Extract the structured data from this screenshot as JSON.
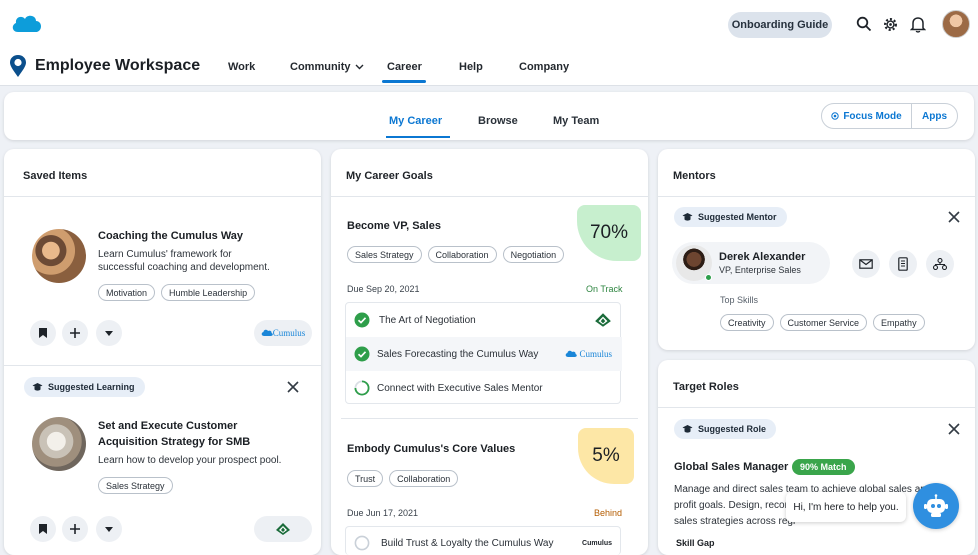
{
  "header": {
    "brand_title": "Employee Workspace",
    "onboarding_label": "Onboarding Guide",
    "nav": [
      {
        "label": "Work"
      },
      {
        "label": "Community"
      },
      {
        "label": "Career"
      },
      {
        "label": "Help"
      },
      {
        "label": "Company"
      }
    ],
    "active_nav": "Career",
    "icons": [
      "search-icon",
      "gear-icon",
      "bell-icon",
      "user-avatar"
    ]
  },
  "subnav": {
    "tabs": [
      {
        "label": "My Career"
      },
      {
        "label": "Browse"
      },
      {
        "label": "My Team"
      }
    ],
    "active_tab": "My Career",
    "focus_mode_label": "Focus Mode",
    "apps_label": "Apps"
  },
  "saved_items": {
    "title": "Saved Items",
    "item1": {
      "title": "Coaching the Cumulus Way",
      "desc_line1": "Learn Cumulus' framework for",
      "desc_line2": "successful coaching and development.",
      "tags": [
        "Motivation",
        "Humble Leadership"
      ],
      "logo_text": "Cumulus"
    },
    "suggested_label": "Suggested Learning",
    "item2": {
      "title_line1": "Set and Execute Customer",
      "title_line2": "Acquisition Strategy for SMB",
      "desc": "Learn how to develop your prospect pool.",
      "tags": [
        "Sales Strategy"
      ]
    }
  },
  "career_goals": {
    "title": "My Career Goals",
    "goal1": {
      "title": "Become VP, Sales",
      "percent": "70%",
      "tags": [
        "Sales Strategy",
        "Collaboration",
        "Negotiation"
      ],
      "due": "Due Sep 20, 2021",
      "status": "On Track",
      "tasks": [
        {
          "label": "The Art of Negotiation"
        },
        {
          "label": "Sales Forecasting the Cumulus Way",
          "logo": "Cumulus"
        },
        {
          "label": "Connect with Executive Sales Mentor"
        }
      ]
    },
    "goal2": {
      "title": "Embody Cumulus's Core Values",
      "percent": "5%",
      "tags": [
        "Trust",
        "Collaboration"
      ],
      "due": "Due Jun 17, 2021",
      "status": "Behind",
      "tasks": [
        {
          "label": "Build Trust & Loyalty the Cumulus Way",
          "logo": "Cumulus"
        }
      ]
    }
  },
  "mentors": {
    "title": "Mentors",
    "suggested_label": "Suggested Mentor",
    "name": "Derek Alexander",
    "role": "VP, Enterprise Sales",
    "top_skills_label": "Top Skills",
    "skills": [
      "Creativity",
      "Customer Service",
      "Empathy"
    ]
  },
  "target_roles": {
    "title": "Target Roles",
    "suggested_label": "Suggested Role",
    "role_title": "Global Sales Manager",
    "match": "90% Match",
    "desc_line1": "Manage and direct sales team to achieve global sales and",
    "desc_line2": "profit goals. Design, recomm",
    "desc_line3": "sales strategies across regi",
    "skill_gap_label": "Skill Gap"
  },
  "assistant": {
    "bubble": "Hi, I'm here to help you."
  },
  "colors": {
    "accent": "#0b77d2",
    "on_track": "#2e8540",
    "behind": "#b45c00",
    "progress_green": "#c7efce",
    "progress_yellow": "#fde7a6"
  }
}
